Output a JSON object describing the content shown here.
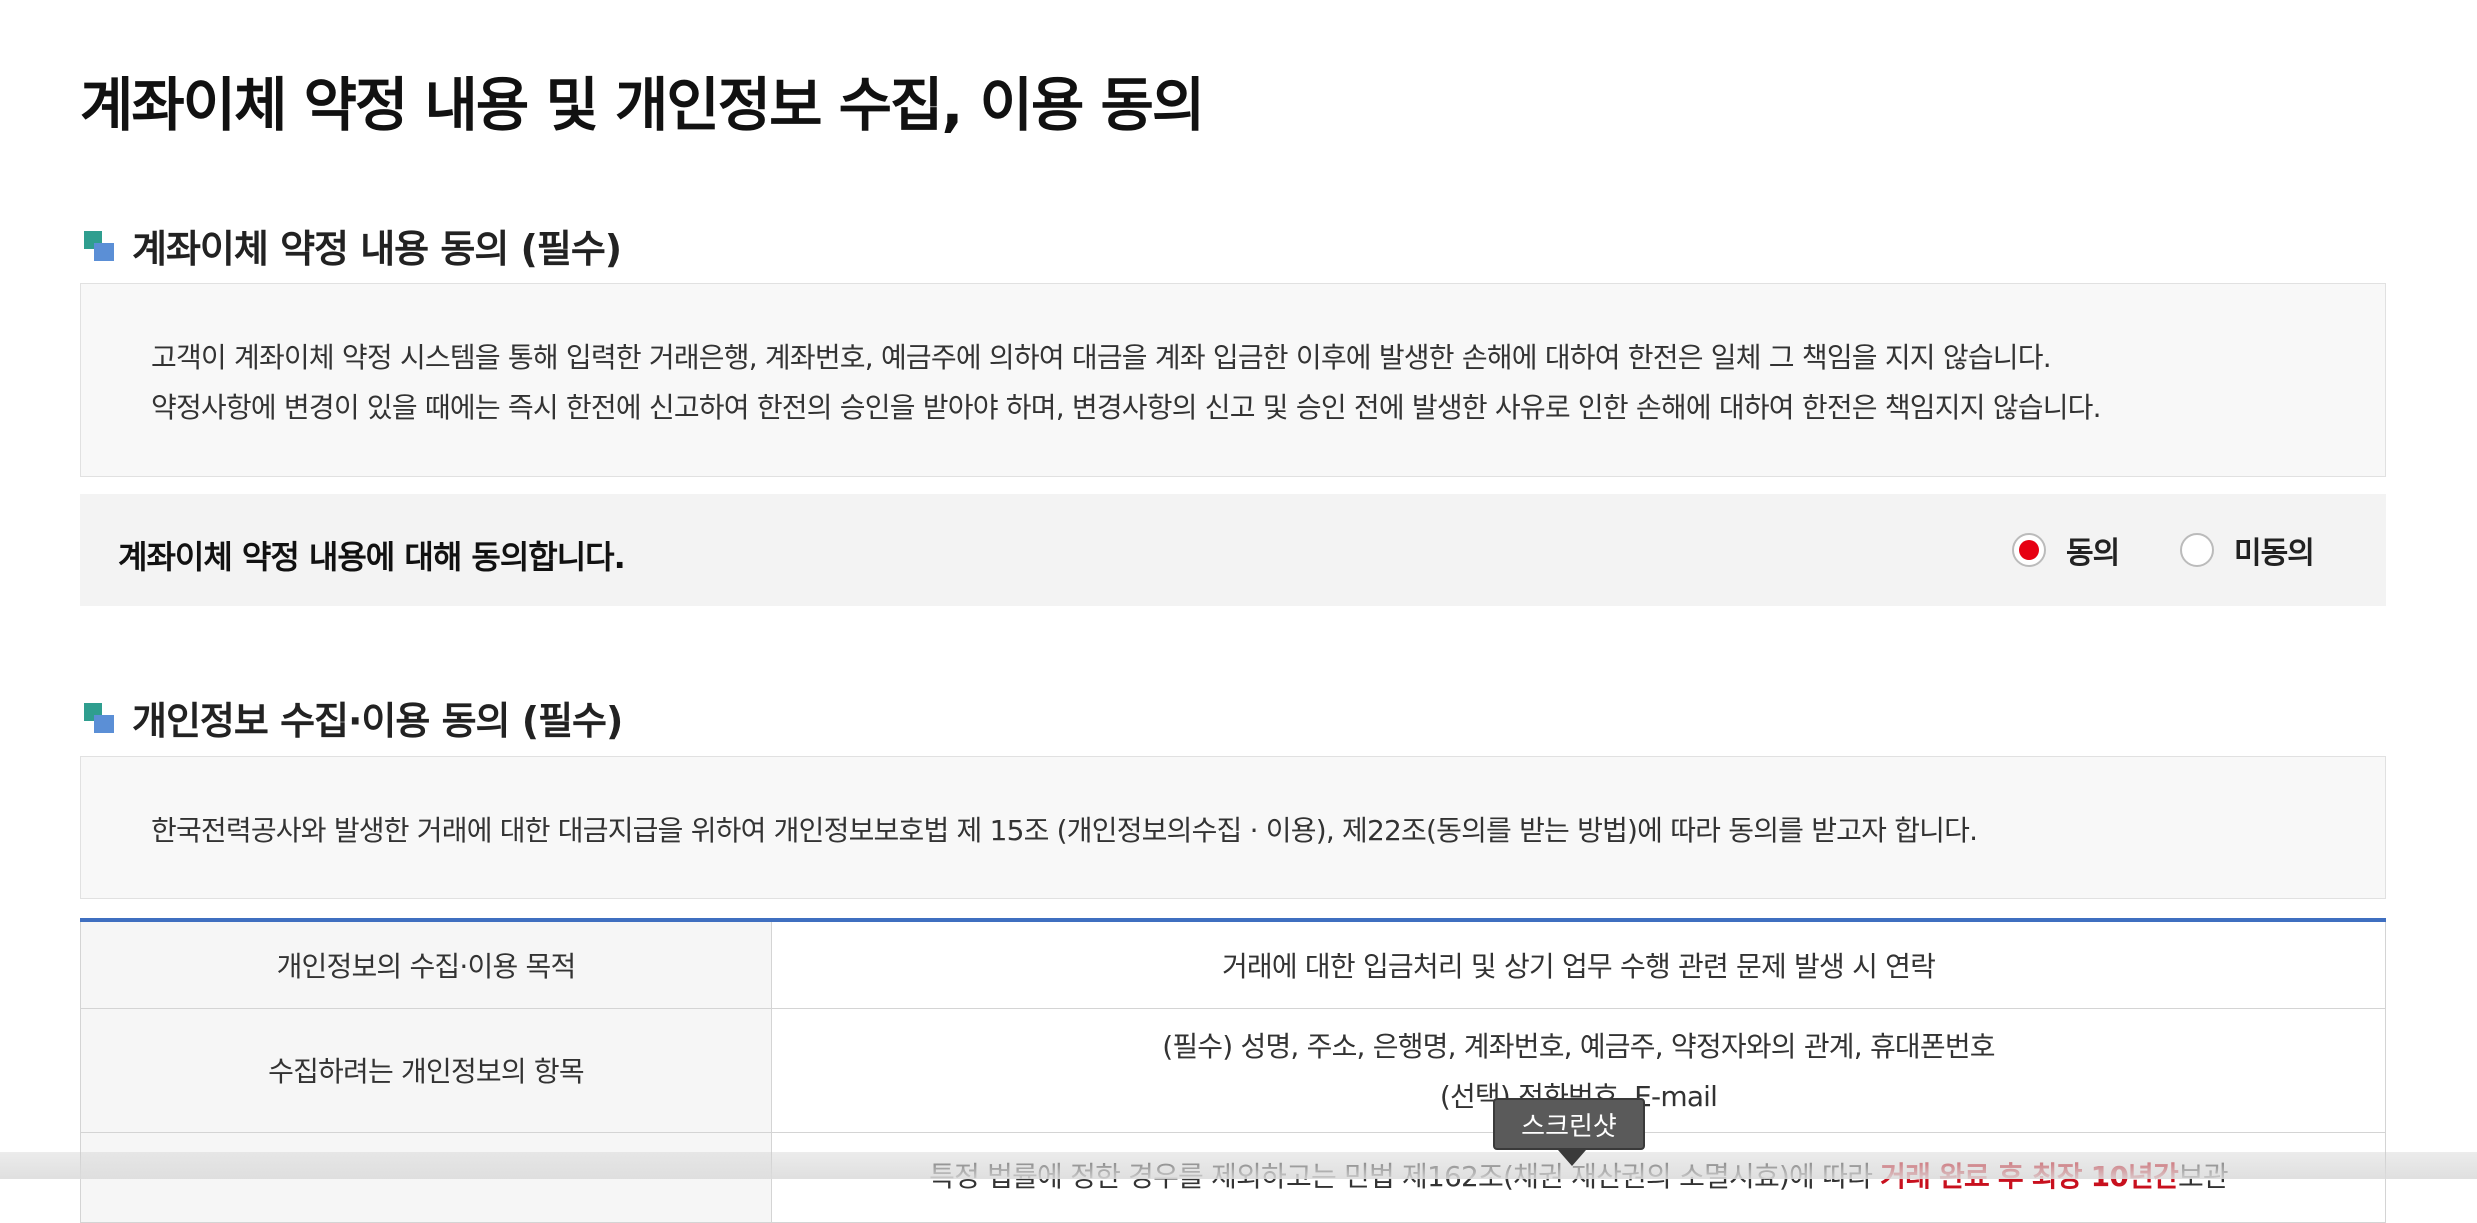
{
  "page_title": "계좌이체 약정 내용 및 개인정보 수집, 이용 동의",
  "section1": {
    "title": "계좌이체 약정 내용 동의 (필수)",
    "lines": [
      "고객이 계좌이체 약정 시스템을 통해 입력한 거래은행, 계좌번호, 예금주에 의하여 대금을 계좌 입금한 이후에 발생한 손해에 대하여 한전은 일체 그 책임을 지지 않습니다.",
      "약정사항에 변경이 있을 때에는 즉시 한전에 신고하여 한전의 승인을 받아야 하며, 변경사항의 신고 및 승인 전에 발생한 사유로 인한 손해에 대하여 한전은 책임지지 않습니다."
    ]
  },
  "agreement": {
    "label": "계좌이체 약정 내용에 대해 동의합니다.",
    "options": [
      "동의",
      "미동의"
    ],
    "selected": "동의",
    "accent_color": "#e60012"
  },
  "section2": {
    "title": "개인정보 수집·이용 동의 (필수)",
    "intro": "한국전력공사와 발생한 거래에 대한 대금지급을 위하여 개인정보보호법 제 15조 (개인정보의수집 · 이용), 제22조(동의를 받는 방법)에 따라 동의를 받고자 합니다.",
    "table": {
      "rows": [
        {
          "label": "개인정보의 수집·이용 목적",
          "value": "거래에 대한 입금처리 및 상기 업무 수행 관련 문제 발생 시 연락"
        },
        {
          "label": "수집하려는 개인정보의 항목",
          "value_line1": "(필수) 성명, 주소, 은행명, 계좌번호, 예금주, 약정자와의 관계, 휴대폰번호",
          "value_line2": "(선택) 전화번호, E-mail"
        },
        {
          "label": "",
          "value_prefix": "특정 법률에 정한 경우를 제외하고는 민법 제162조(채권 재산권의 소멸시효)에 따라 ",
          "value_emphasis": "거래 완료 후 최장 10년간",
          "value_suffix": "보관"
        }
      ]
    }
  },
  "tooltip": {
    "label": "스크린샷"
  }
}
